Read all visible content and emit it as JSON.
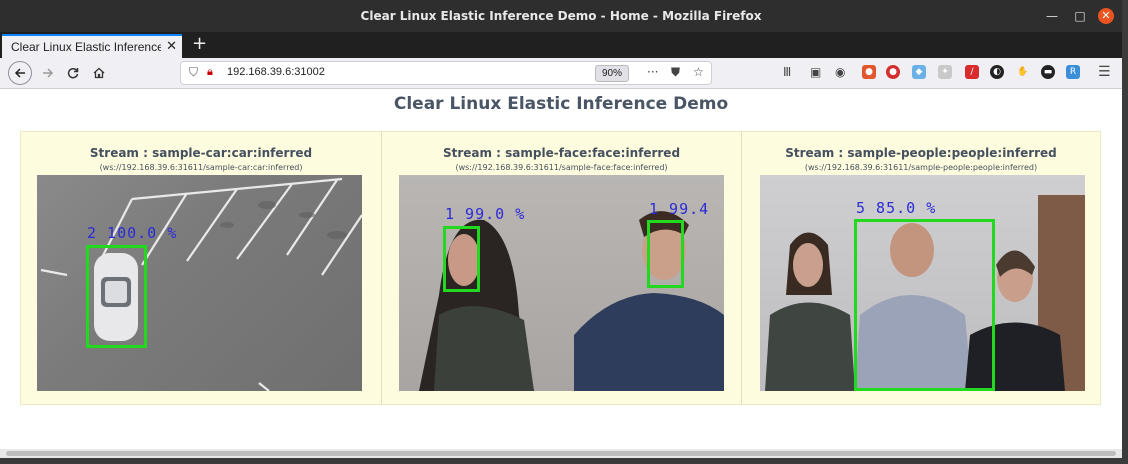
{
  "window": {
    "title": "Clear Linux Elastic Inference Demo - Home - Mozilla Firefox",
    "minimize": "—",
    "maximize": "□",
    "close": "✕"
  },
  "tabs": [
    {
      "label": "Clear Linux Elastic Inference",
      "close": "✕"
    }
  ],
  "new_tab": "+",
  "nav": {
    "url": "192.168.39.6:31002",
    "zoom": "90%",
    "more": "···"
  },
  "page": {
    "title": "Clear Linux Elastic Inference Demo",
    "streams": [
      {
        "title": "Stream : sample-car:car:inferred",
        "url": "(ws://192.168.39.6:31611/sample-car:car:inferred)",
        "detections": [
          {
            "label": "2 100.0 %"
          }
        ]
      },
      {
        "title": "Stream : sample-face:face:inferred",
        "url": "(ws://192.168.39.6:31611/sample-face:face:inferred)",
        "detections": [
          {
            "label": "1 99.0 %"
          },
          {
            "label": "1 99.4"
          }
        ]
      },
      {
        "title": "Stream : sample-people:people:inferred",
        "url": "(ws://192.168.39.6:31611/sample-people:people:inferred)",
        "detections": [
          {
            "label": "5 85.0 %"
          }
        ]
      }
    ]
  },
  "colors": {
    "box": "#22d91f",
    "label": "#2b2bd6",
    "panel": "#fefcdf"
  }
}
